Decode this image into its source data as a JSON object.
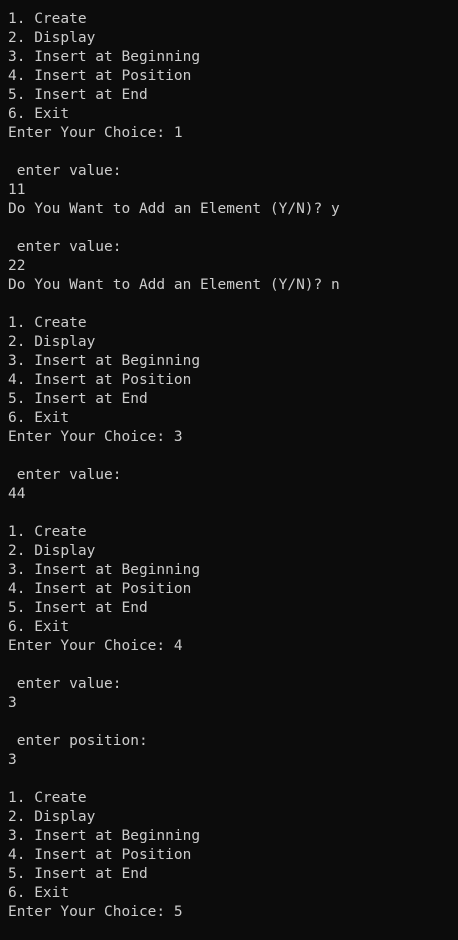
{
  "terminal": {
    "lines": [
      "1. Create",
      "2. Display",
      "3. Insert at Beginning",
      "4. Insert at Position",
      "5. Insert at End",
      "6. Exit",
      "Enter Your Choice: 1",
      "",
      " enter value:",
      "11",
      "Do You Want to Add an Element (Y/N)? y",
      "",
      " enter value:",
      "22",
      "Do You Want to Add an Element (Y/N)? n",
      "",
      "1. Create",
      "2. Display",
      "3. Insert at Beginning",
      "4. Insert at Position",
      "5. Insert at End",
      "6. Exit",
      "Enter Your Choice: 3",
      "",
      " enter value:",
      "44",
      "",
      "1. Create",
      "2. Display",
      "3. Insert at Beginning",
      "4. Insert at Position",
      "5. Insert at End",
      "6. Exit",
      "Enter Your Choice: 4",
      "",
      " enter value:",
      "3",
      "",
      " enter position:",
      "3",
      "",
      "1. Create",
      "2. Display",
      "3. Insert at Beginning",
      "4. Insert at Position",
      "5. Insert at End",
      "6. Exit",
      "Enter Your Choice: 5"
    ]
  }
}
